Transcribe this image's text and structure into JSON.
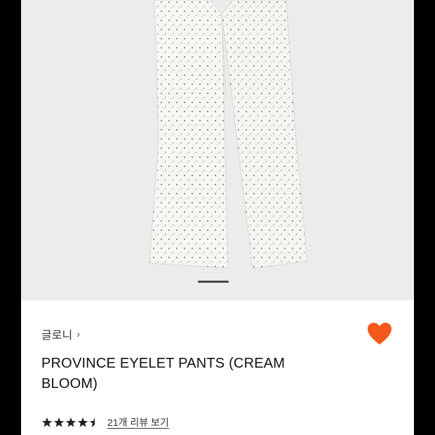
{
  "product": {
    "brand": "글로니",
    "title_line1": "PROVINCE EYELET PANTS (CREAM",
    "title_line2": "BLOOM)",
    "image_subject": "cream eyelet wide-leg pants",
    "rating_value": 4.5,
    "rating_max": 5,
    "review_link": "21개 리뷰 보기",
    "wishlisted": true
  },
  "gallery": {
    "active_page": 1
  },
  "icons": {
    "brand_chevron": "chevron-right-icon",
    "wishlist": "heart-icon",
    "rating": "star-icon"
  },
  "colors": {
    "heart": "#f4581c",
    "star": "#222222",
    "gallery_bg": "#ececec",
    "page_bg": "#ffffff",
    "outer_bg": "#000000"
  }
}
